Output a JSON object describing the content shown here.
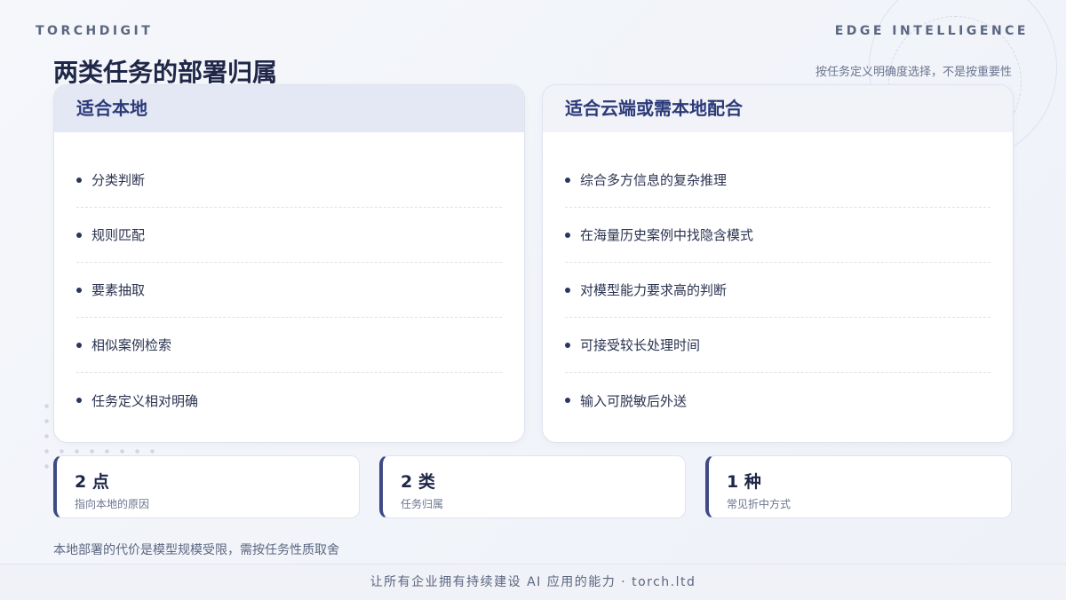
{
  "brand": {
    "left": "TORCHDIGIT",
    "right": "EDGE INTELLIGENCE"
  },
  "header": {
    "title": "两类任务的部署归属",
    "subtitle": "按任务定义明确度选择，不是按重要性"
  },
  "cards": [
    {
      "title": "适合本地",
      "items": [
        "分类判断",
        "规则匹配",
        "要素抽取",
        "相似案例检索",
        "任务定义相对明确"
      ]
    },
    {
      "title": "适合云端或需本地配合",
      "items": [
        "综合多方信息的复杂推理",
        "在海量历史案例中找隐含模式",
        "对模型能力要求高的判断",
        "可接受较长处理时间",
        "输入可脱敏后外送"
      ]
    }
  ],
  "stats": [
    {
      "value": "2 点",
      "label": "指向本地的原因"
    },
    {
      "value": "2 类",
      "label": "任务归属"
    },
    {
      "value": "1 种",
      "label": "常见折中方式"
    }
  ],
  "note": "本地部署的代价是模型规模受限，需按任务性质取舍",
  "footer": "让所有企业拥有持续建设 AI 应用的能力 · torch.ltd"
}
